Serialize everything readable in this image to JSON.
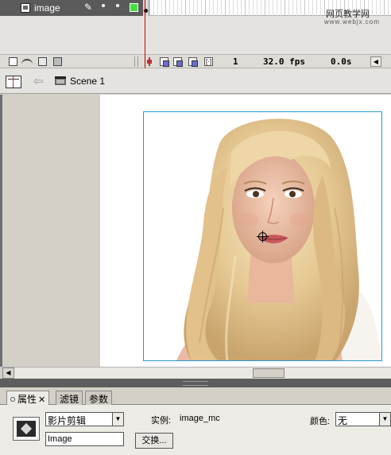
{
  "timeline": {
    "layer_name": "image",
    "current_frame": "1",
    "frame_rate": "32.0 fps",
    "elapsed_time": "0.0s"
  },
  "watermark": {
    "line1": "网页教学网",
    "line2": "www.webjx.com"
  },
  "edit_bar": {
    "scene_name": "Scene 1"
  },
  "stage": {
    "image_description_icon": "portrait-photo"
  },
  "properties": {
    "tabs": [
      "属性",
      "滤镜",
      "参数"
    ],
    "tab_close_glyph": "✕",
    "symbol_type": "影片剪辑",
    "instance_label": "实例:",
    "instance_name": "image_mc",
    "instance_name_field": "Image",
    "swap_label": "交换...",
    "color_label": "颜色:",
    "color_effect": "无"
  },
  "colors": {
    "layer_row_bg": "#5a5a5a",
    "outline_swatch": "#44dd44",
    "playhead": "#cc0000",
    "selection_border": "#2a9ad2"
  }
}
